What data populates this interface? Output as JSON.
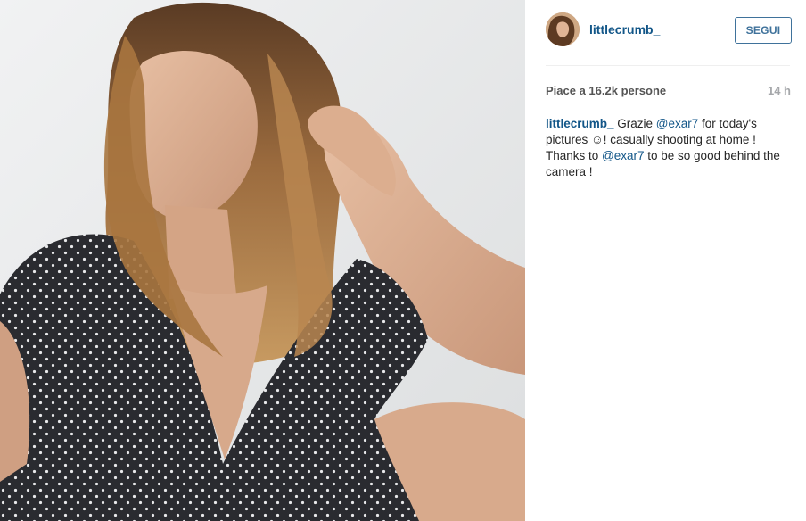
{
  "post": {
    "username": "littlecrumb_",
    "follow_label": "SEGUI",
    "likes_text": "Piace a 16.2k persone",
    "time_ago": "14 h",
    "caption": {
      "user": "littlecrumb_",
      "part1": " Grazie ",
      "mention1": "@exar7",
      "part2": " for today's pictures ☺! casually shooting at home ! Thanks to ",
      "mention2": "@exar7",
      "part3": " to be so good behind the camera !"
    }
  },
  "colors": {
    "link_blue": "#125688",
    "button_blue": "#3f729b",
    "divider": "#efefef",
    "muted": "#a5a7aa"
  },
  "icons": {
    "avatar": "profile-avatar"
  }
}
